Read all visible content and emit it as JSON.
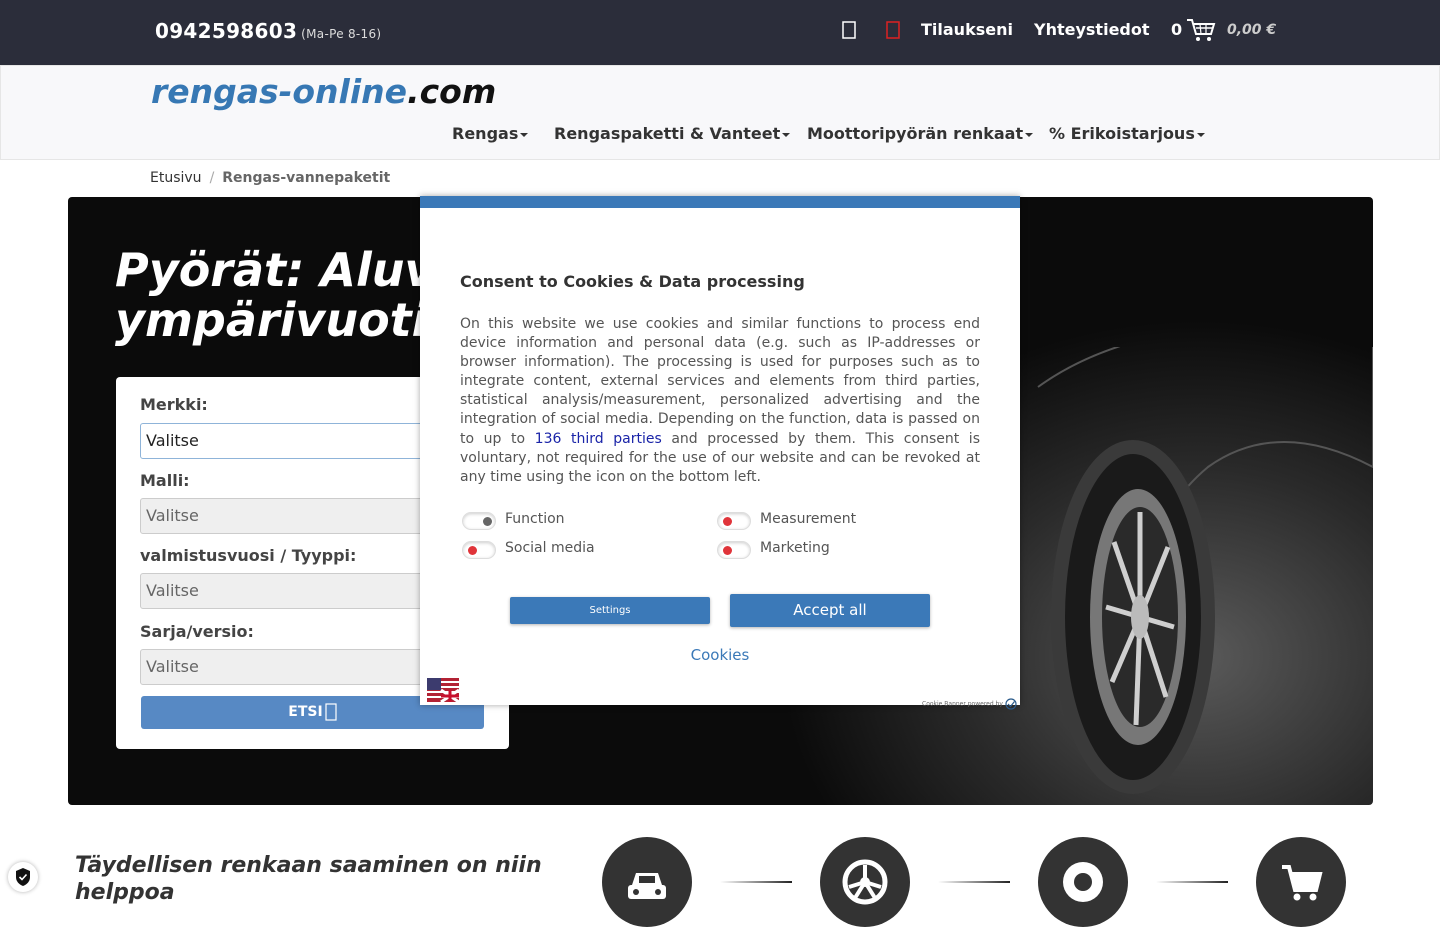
{
  "topbar": {
    "phone": "0942598603",
    "hours": "(Ma-Pe 8-16)",
    "orders_label": "Tilaukseni",
    "contact_label": "Yhteystiedot",
    "cart_count": "0",
    "cart_total": "0,00 €"
  },
  "logo": {
    "part1": "rengas-online",
    "part2": ".com"
  },
  "menu": [
    {
      "label": "Rengas"
    },
    {
      "label": "Rengaspaketti & Vanteet"
    },
    {
      "label": "Moottoripyörän renkaat"
    },
    {
      "label": "% Erikoistarjous"
    }
  ],
  "breadcrumb": {
    "home": "Etusivu",
    "current": "Rengas-vannepaketit"
  },
  "hero": {
    "title_line1": "Pyörät: Aluv",
    "title_line2": "ympärivuoti"
  },
  "search": {
    "fields": [
      {
        "label": "Merkki:",
        "value": "Valitse"
      },
      {
        "label": "Malli:",
        "value": "Valitse"
      },
      {
        "label": "valmistusvuosi / Tyyppi:",
        "value": "Valitse"
      },
      {
        "label": "Sarja/versio:",
        "value": "Valitse"
      }
    ],
    "button": "ETSI"
  },
  "consent": {
    "title": "Consent to Cookies & Data processing",
    "text_before": "On this website we use cookies and similar functions to process end device information and personal data (e.g. such as IP-addresses or browser information). The processing is used for purposes such as to integrate content, external services and elements from third parties, statistical analysis/measurement, personalized advertising and the integration of social media. Depending on the function, data is passed on to up to ",
    "link": "136 third parties",
    "text_after": " and processed by them. This consent is voluntary, not required for the use of our website and can be revoked at any time using the icon on the bottom left.",
    "toggles": [
      {
        "label": "Function",
        "state": "locked"
      },
      {
        "label": "Measurement",
        "state": "off"
      },
      {
        "label": "Social media",
        "state": "off"
      },
      {
        "label": "Marketing",
        "state": "off"
      }
    ],
    "settings_button": "Settings",
    "accept_button": "Accept all",
    "cookies_link": "Cookies",
    "powered_by": "Cookie Banner powered by"
  },
  "bottom": {
    "title": "Täydellisen renkaan saaminen on niin helppoa",
    "steps": [
      "car-icon",
      "wheel-icon",
      "tire-icon",
      "cart-icon"
    ]
  },
  "colors": {
    "accent": "#3b79b8",
    "topbar": "#2b2d3a",
    "toggle_off": "#e0343a"
  }
}
